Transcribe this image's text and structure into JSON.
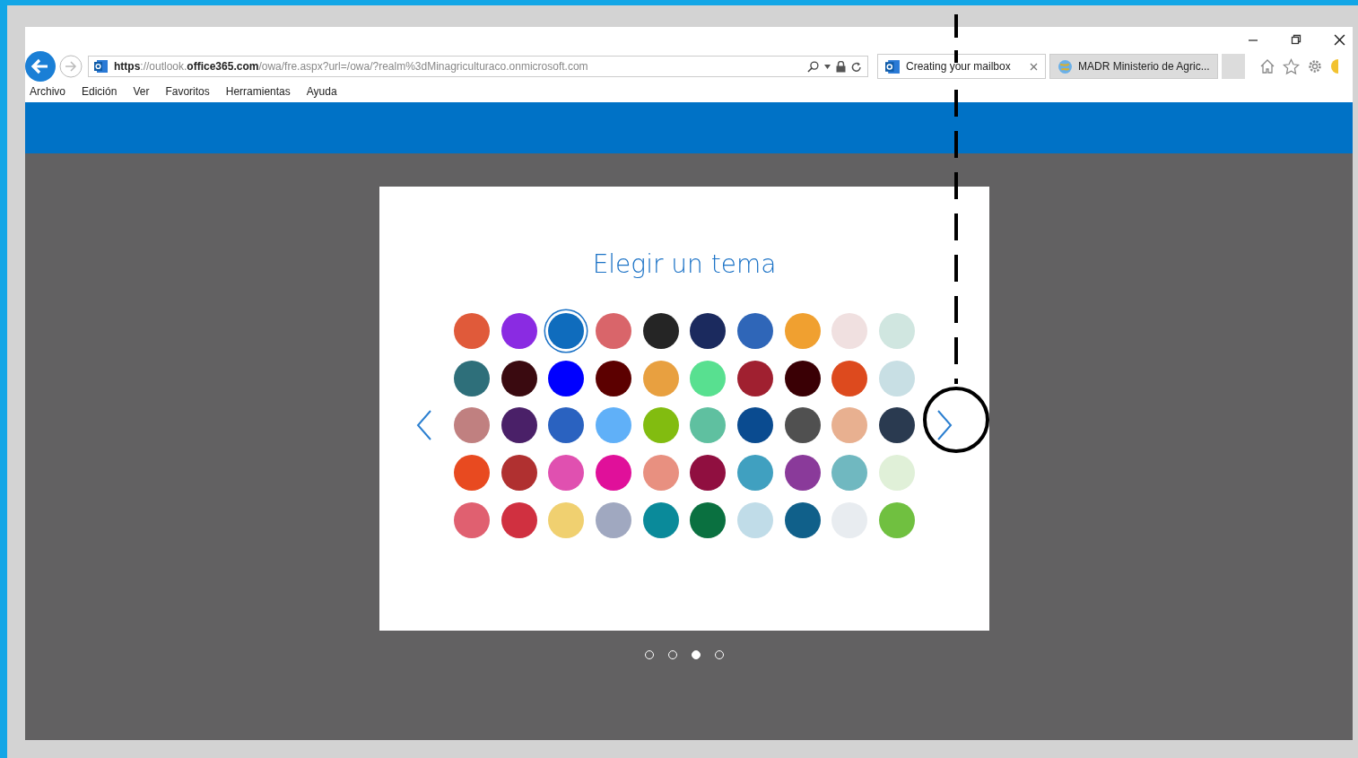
{
  "browser": {
    "address": "**https**://outlook.**office365.com**/owa/fre.aspx?url=/owa/?realm%3dMinagriculturaco.onmicrosoft.com",
    "tabs": [
      {
        "label": "Creating your mailbox",
        "selected": true
      },
      {
        "label": "MADR Ministerio de Agric...",
        "selected": false
      }
    ],
    "menu": [
      "Archivo",
      "Edición",
      "Ver",
      "Favoritos",
      "Herramientas",
      "Ayuda"
    ]
  },
  "dialog": {
    "title": "Elegir un tema",
    "themes": [
      {
        "color": "#e05a3a",
        "selected": false
      },
      {
        "color": "#8a2be2",
        "selected": false
      },
      {
        "color": "#0f6cbd",
        "selected": true
      },
      {
        "color": "#d9656a",
        "selected": false
      },
      {
        "color": "#252525",
        "selected": false
      },
      {
        "color": "#1b2a5e",
        "selected": false
      },
      {
        "color": "#2f66b8",
        "selected": false
      },
      {
        "color": "#f0a030",
        "selected": false
      },
      {
        "color": "#f0e0e0",
        "selected": false
      },
      {
        "color": "#d0e6e0",
        "selected": false
      },
      {
        "color": "#2e6f7a",
        "selected": false
      },
      {
        "color": "#3a0a10",
        "selected": false
      },
      {
        "color": "#0000ff",
        "selected": false
      },
      {
        "color": "#5c0000",
        "selected": false
      },
      {
        "color": "#e8a040",
        "selected": false
      },
      {
        "color": "#58e090",
        "selected": false
      },
      {
        "color": "#a02030",
        "selected": false
      },
      {
        "color": "#3a0005",
        "selected": false
      },
      {
        "color": "#dd4a1e",
        "selected": false
      },
      {
        "color": "#c8dfe4",
        "selected": false
      },
      {
        "color": "#c08080",
        "selected": false
      },
      {
        "color": "#4a2068",
        "selected": false
      },
      {
        "color": "#2a62c0",
        "selected": false
      },
      {
        "color": "#60b0f8",
        "selected": false
      },
      {
        "color": "#82bc10",
        "selected": false
      },
      {
        "color": "#5fc0a0",
        "selected": false
      },
      {
        "color": "#0a4b90",
        "selected": false
      },
      {
        "color": "#505050",
        "selected": false
      },
      {
        "color": "#e8b090",
        "selected": false
      },
      {
        "color": "#2a3a50",
        "selected": false
      },
      {
        "color": "#e84a20",
        "selected": false
      },
      {
        "color": "#b03030",
        "selected": false
      },
      {
        "color": "#e050b0",
        "selected": false
      },
      {
        "color": "#e0109a",
        "selected": false
      },
      {
        "color": "#e89080",
        "selected": false
      },
      {
        "color": "#900f40",
        "selected": false
      },
      {
        "color": "#40a0c0",
        "selected": false
      },
      {
        "color": "#8a3a9a",
        "selected": false
      },
      {
        "color": "#70b8c0",
        "selected": false
      },
      {
        "color": "#e0f0d8",
        "selected": false
      },
      {
        "color": "#e06070",
        "selected": false
      },
      {
        "color": "#d03040",
        "selected": false
      },
      {
        "color": "#f0d070",
        "selected": false
      },
      {
        "color": "#a0a8c0",
        "selected": false
      },
      {
        "color": "#0a8a9a",
        "selected": false
      },
      {
        "color": "#0a7040",
        "selected": false
      },
      {
        "color": "#c0dce8",
        "selected": false
      },
      {
        "color": "#10608a",
        "selected": false
      },
      {
        "color": "#e8ecf0",
        "selected": false
      },
      {
        "color": "#70c040",
        "selected": false
      }
    ],
    "pages": [
      {
        "selected": false
      },
      {
        "selected": false
      },
      {
        "selected": true
      },
      {
        "selected": false
      }
    ]
  }
}
